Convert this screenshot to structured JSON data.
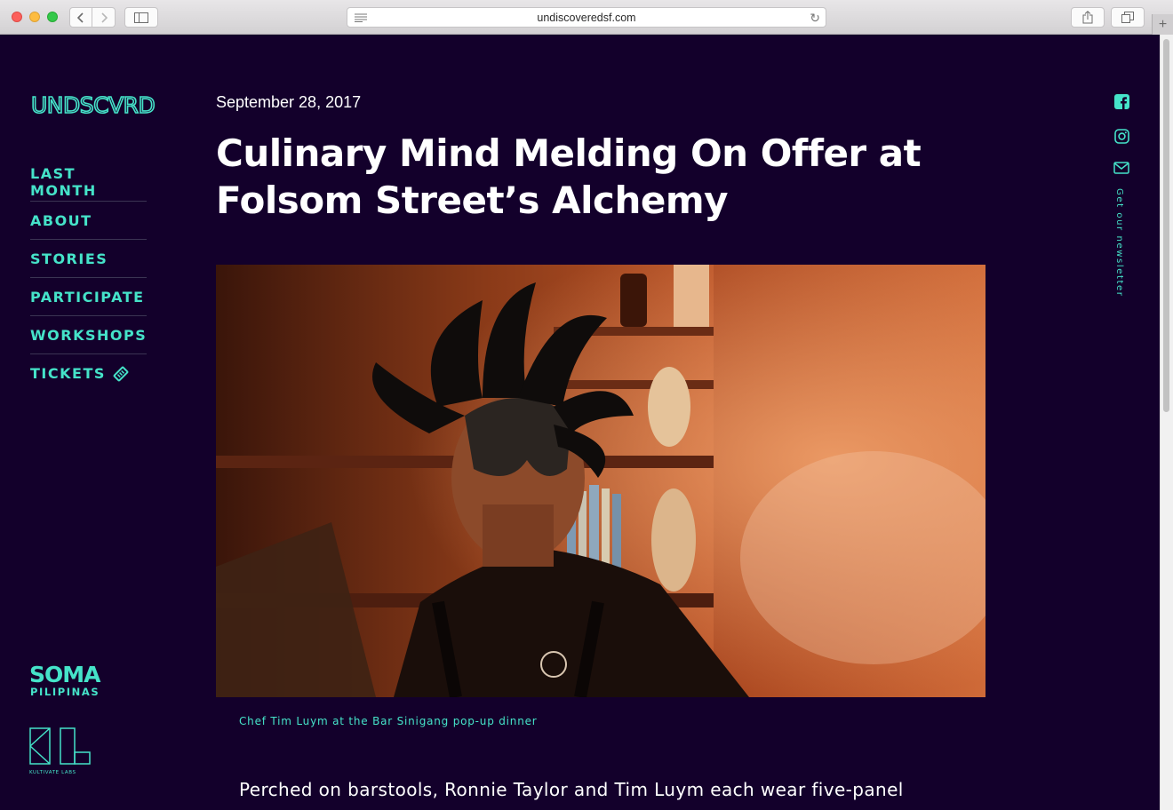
{
  "browser": {
    "url": "undiscoveredsf.com"
  },
  "site": {
    "logo_text": "UNDSCVRD",
    "nav": [
      {
        "label": "LAST MONTH"
      },
      {
        "label": "ABOUT"
      },
      {
        "label": "STORIES"
      },
      {
        "label": "PARTICIPATE"
      },
      {
        "label": "WORKSHOPS"
      },
      {
        "label": "TICKETS"
      }
    ],
    "partners": {
      "soma_line1": "SOMA",
      "soma_line2": "PILIPINAS",
      "kultivate": "KULTIVATE LABS"
    },
    "newsletter": "Get our newsletter",
    "social_icons": [
      "facebook-icon",
      "instagram-icon",
      "mail-icon"
    ],
    "accent_color": "#45e3c9",
    "background_color": "#13002b"
  },
  "article": {
    "date": "September 28, 2017",
    "title": "Culinary Mind Melding On Offer at Folsom Street’s Alchemy",
    "image_caption": "Chef Tim Luym at the Bar Sinigang pop-up dinner",
    "body_first_line": "Perched on barstools, Ronnie Taylor and Tim Luym each wear five-panel"
  }
}
